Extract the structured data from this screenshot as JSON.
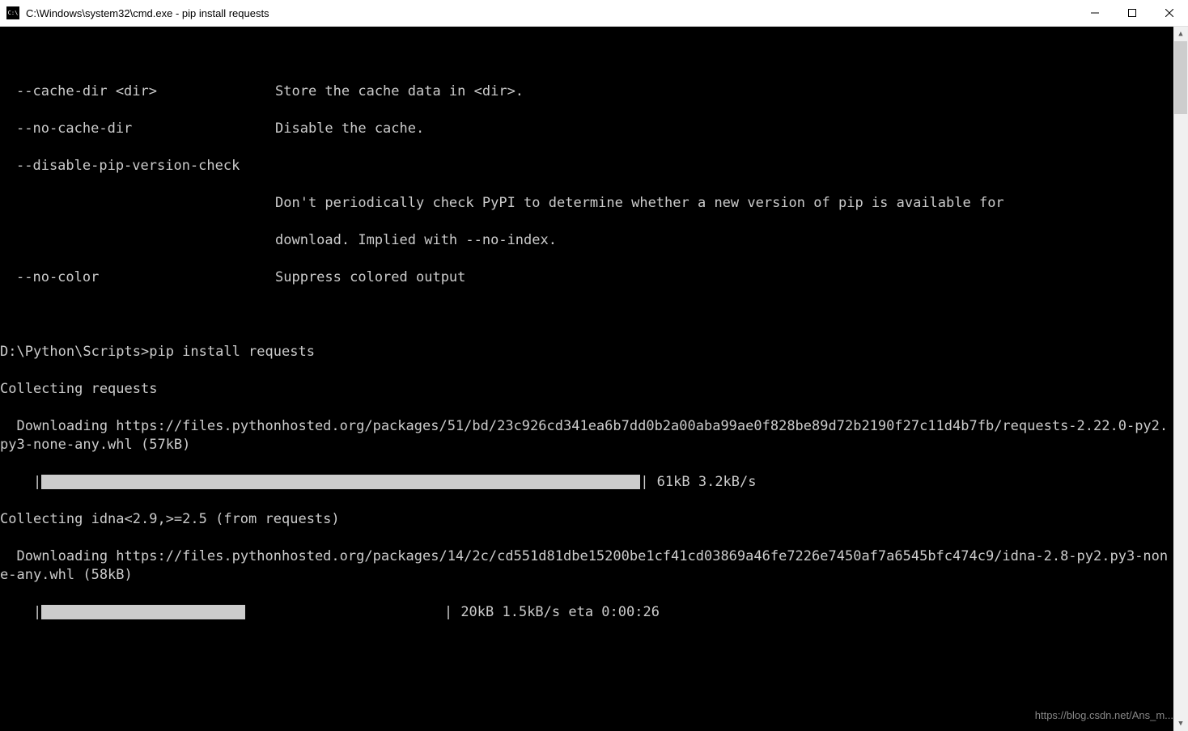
{
  "window": {
    "title": "C:\\Windows\\system32\\cmd.exe - pip  install requests"
  },
  "terminal": {
    "options": [
      {
        "flag": "--cache-dir <dir>",
        "desc": "Store the cache data in <dir>."
      },
      {
        "flag": "--no-cache-dir",
        "desc": "Disable the cache."
      },
      {
        "flag": "--disable-pip-version-check",
        "desc": ""
      },
      {
        "flag": "",
        "desc": "Don't periodically check PyPI to determine whether a new version of pip is available for"
      },
      {
        "flag": "",
        "desc": "download. Implied with --no-index."
      },
      {
        "flag": "--no-color",
        "desc": "Suppress colored output"
      }
    ],
    "prompt": "D:\\Python\\Scripts>",
    "command": "pip install requests",
    "lines": {
      "collecting1": "Collecting requests",
      "downloading1": "  Downloading https://files.pythonhosted.org/packages/51/bd/23c926cd341ea6b7dd0b2a00aba99ae0f828be89d72b2190f27c11d4b7fb/requests-2.22.0-py2.py3-none-any.whl (57kB)",
      "progress1_prefix": "    |",
      "progress1_suffix": "| 61kB 3.2kB/s",
      "progress1_filled_width": 740,
      "collecting2": "Collecting idna<2.9,>=2.5 (from requests)",
      "downloading2": "  Downloading https://files.pythonhosted.org/packages/14/2c/cd551d81dbe15200be1cf41cd03869a46fe7226e7450af7a6545bfc474c9/idna-2.8-py2.py3-none-any.whl (58kB)",
      "progress2_prefix": "    |",
      "progress2_middle": "                        ",
      "progress2_suffix": "| 20kB 1.5kB/s eta 0:00:26",
      "progress2_filled_width": 252
    }
  },
  "watermark": "https://blog.csdn.net/Ans_m..."
}
